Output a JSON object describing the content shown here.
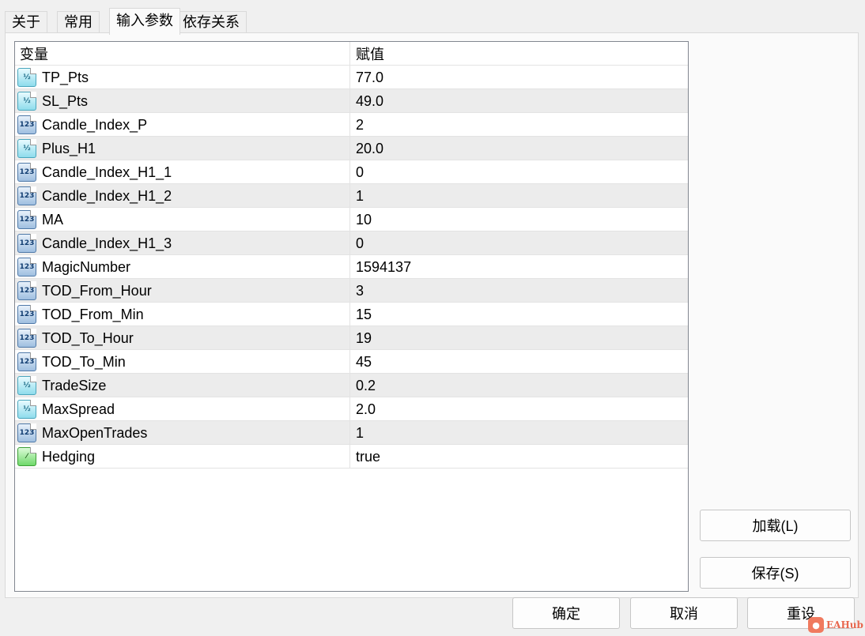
{
  "tabs": [
    {
      "label": "关于"
    },
    {
      "label": "常用"
    },
    {
      "label": "输入参数"
    },
    {
      "label": "依存关系"
    }
  ],
  "active_tab": "输入参数",
  "table": {
    "headers": {
      "variable": "变量",
      "value": "赋值"
    },
    "rows": [
      {
        "name": "TP_Pts",
        "value": "77.0",
        "icon": "double-icon",
        "icon_text": "½"
      },
      {
        "name": "SL_Pts",
        "value": "49.0",
        "icon": "double-icon",
        "icon_text": "½"
      },
      {
        "name": "Candle_Index_P",
        "value": "2",
        "icon": "integer-icon",
        "icon_text": "123"
      },
      {
        "name": "Plus_H1",
        "value": "20.0",
        "icon": "double-icon",
        "icon_text": "½"
      },
      {
        "name": "Candle_Index_H1_1",
        "value": "0",
        "icon": "integer-icon",
        "icon_text": "123"
      },
      {
        "name": "Candle_Index_H1_2",
        "value": "1",
        "icon": "integer-icon",
        "icon_text": "123"
      },
      {
        "name": "MA",
        "value": "10",
        "icon": "integer-icon",
        "icon_text": "123"
      },
      {
        "name": "Candle_Index_H1_3",
        "value": "0",
        "icon": "integer-icon",
        "icon_text": "123"
      },
      {
        "name": "MagicNumber",
        "value": "1594137",
        "icon": "integer-icon",
        "icon_text": "123"
      },
      {
        "name": "TOD_From_Hour",
        "value": "3",
        "icon": "integer-icon",
        "icon_text": "123"
      },
      {
        "name": "TOD_From_Min",
        "value": "15",
        "icon": "integer-icon",
        "icon_text": "123"
      },
      {
        "name": "TOD_To_Hour",
        "value": "19",
        "icon": "integer-icon",
        "icon_text": "123"
      },
      {
        "name": "TOD_To_Min",
        "value": "45",
        "icon": "integer-icon",
        "icon_text": "123"
      },
      {
        "name": "TradeSize",
        "value": "0.2",
        "icon": "double-icon",
        "icon_text": "½"
      },
      {
        "name": "MaxSpread",
        "value": "2.0",
        "icon": "double-icon",
        "icon_text": "½"
      },
      {
        "name": "MaxOpenTrades",
        "value": "1",
        "icon": "integer-icon",
        "icon_text": "123"
      },
      {
        "name": "Hedging",
        "value": "true",
        "icon": "boolean-icon",
        "icon_text": "⁄"
      }
    ]
  },
  "side_buttons": {
    "load": "加载(L)",
    "save": "保存(S)"
  },
  "footer_buttons": {
    "ok": "确定",
    "cancel": "取消",
    "reset": "重设"
  },
  "watermark": {
    "text": "EAHub"
  }
}
